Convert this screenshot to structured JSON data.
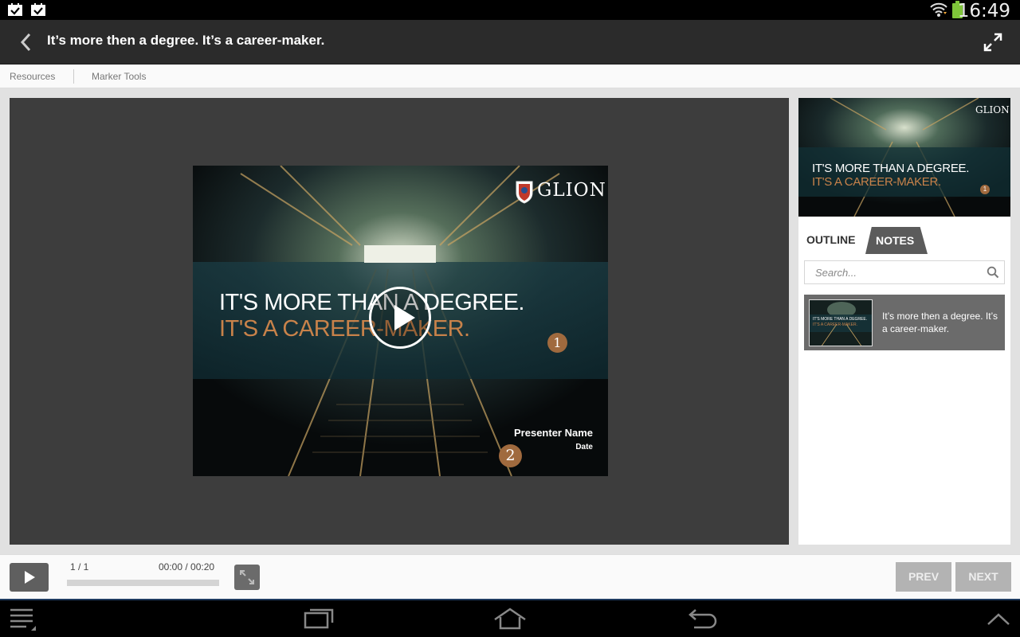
{
  "status_bar": {
    "time": "16:49"
  },
  "header": {
    "title": "It’s more then a degree. It’s a career-maker."
  },
  "menu": {
    "items": [
      "Resources",
      "Marker Tools"
    ]
  },
  "slide": {
    "logo_text": "GLION",
    "headline_1": "IT'S MORE THAN A DEGREE.",
    "headline_2": "IT'S A CAREER-MAKER.",
    "marker_1": "1",
    "marker_2": "2",
    "presenter": "Presenter Name",
    "date": "Date"
  },
  "sidebar": {
    "tabs": {
      "outline": "OUTLINE",
      "notes": "NOTES"
    },
    "search": {
      "placeholder": "Search..."
    },
    "notes_item_text": "It’s more then a degree. It’s a career-maker."
  },
  "controls": {
    "slide_count": "1 / 1",
    "timecode": "00:00 / 00:20",
    "prev_label": "PREV",
    "next_label": "NEXT",
    "progress": 0
  },
  "colors": {
    "accent_orange": "#c8824a",
    "dark": "#2b2b2b",
    "teal": "#2d6e78"
  }
}
